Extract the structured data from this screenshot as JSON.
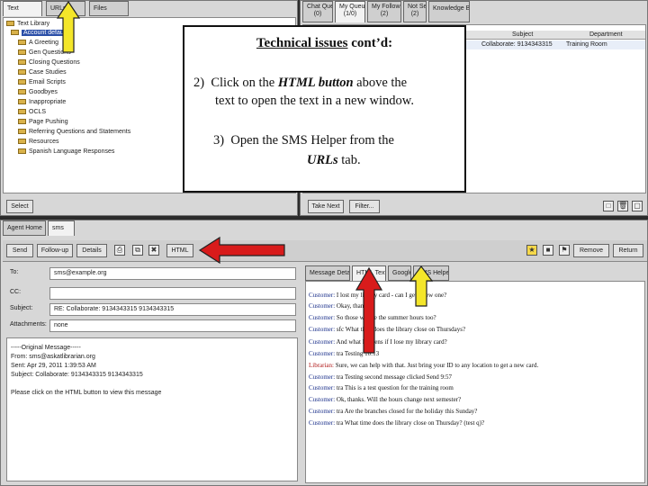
{
  "top_left": {
    "tabs": [
      "Text",
      "URLs",
      "Files"
    ],
    "tree_root": "Text Library",
    "tree_selected": "Account default",
    "tree_items": [
      "A Greeting",
      "Gen Questions",
      "Closing Questions",
      "Case Studies",
      "Email Scripts",
      "Goodbyes",
      "Inappropriate",
      "OCLS",
      "Page Pushing",
      "Referring Questions and Statements",
      "Resources",
      "Spanish Language Responses"
    ],
    "select_button": "Select"
  },
  "top_right": {
    "tabs": [
      {
        "name": "Chat Queues",
        "count": "(0)"
      },
      {
        "name": "My Queue",
        "count": "(1/0)"
      },
      {
        "name": "My Follow-ups",
        "count": "(2)"
      },
      {
        "name": "Not Sent",
        "count": "(2)"
      }
    ],
    "knowledge_tab": "Knowledge Base",
    "columns": [
      "Subject",
      "Department"
    ],
    "row": {
      "subject": "Collaborate: 9134343315",
      "department": "Training Room"
    },
    "take_next_button": "Take Next",
    "filter_button": "Filter..."
  },
  "lower": {
    "tabs": [
      "Agent Home",
      "sms"
    ],
    "toolbar": {
      "send": "Send",
      "followup": "Follow-up",
      "details": "Details",
      "html": "HTML",
      "remove": "Remove",
      "return": "Return"
    },
    "fields": {
      "to_label": "To:",
      "to_value": "sms@example.org",
      "cc_label": "CC:",
      "cc_value": "",
      "subject_label": "Subject:",
      "subject_value": "RE: Collaborate: 9134343315 9134343315",
      "attach_label": "Attachments:",
      "attach_value": "none"
    },
    "body_lines": [
      "-----Original Message-----",
      "From: sms@askatlibrarian.org",
      "Sent: Apr 29, 2011 1:39:53 AM",
      "Subject: Collaborate: 9134343315 9134343315",
      "",
      "Please click on the HTML button to view this message"
    ],
    "right_tabs": [
      "Message Details",
      "HTML Text",
      "Google",
      "SMS Helper"
    ],
    "chat": [
      {
        "who": "Customer:",
        "text": "I lost my library card - can I get a new one?",
        "red": false
      },
      {
        "who": "Customer:",
        "text": "Okay, thanks!",
        "red": false
      },
      {
        "who": "Customer:",
        "text": "So those will be the summer hours too?",
        "red": false
      },
      {
        "who": "Customer:",
        "text": "sfc What time does the library close on Thursdays?",
        "red": false
      },
      {
        "who": "Customer:",
        "text": "And what happens if I lose my library card?",
        "red": false
      },
      {
        "who": "Customer:",
        "text": "tra Testing 10:13",
        "red": false
      },
      {
        "who": "Librarian:",
        "text": "Sure, we can help with that. Just bring your ID to any location to get a new card.",
        "red": true
      },
      {
        "who": "Customer:",
        "text": "tra Testing second message clicked Send 9:57",
        "red": false
      },
      {
        "who": "Customer:",
        "text": "tra This is a test question for the training room",
        "red": false
      },
      {
        "who": "Customer:",
        "text": "Ok, thanks. Will the hours change next semester?",
        "red": false
      },
      {
        "who": "Customer:",
        "text": "tra Are the branches closed for the holiday this Sunday?",
        "red": false
      },
      {
        "who": "Customer:",
        "text": "tra What time does the library close on Thursday? (test q)?",
        "red": false
      }
    ]
  },
  "overlay": {
    "title_underlined": "Technical issues",
    "title_rest": " cont’d:",
    "item2_num": "2)",
    "item2_pre": "Click on the ",
    "item2_bold": "HTML button",
    "item2_post": " above the",
    "item2_line2": "text to open the text in a new window.",
    "item3_num": "3)",
    "item3_line1": "Open the SMS Helper from the",
    "item3_bold": "URLs",
    "item3_post": " tab."
  },
  "colors": {
    "arrow_red": "#d81b1b",
    "arrow_yellow": "#f4e62a"
  }
}
